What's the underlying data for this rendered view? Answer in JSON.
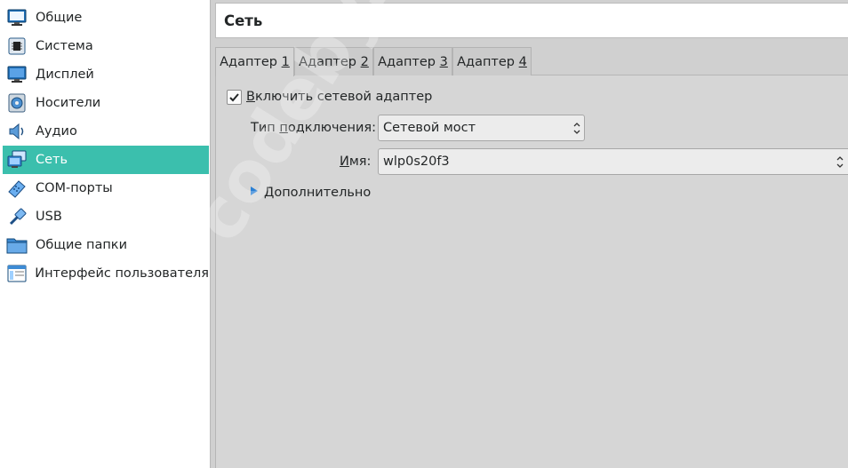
{
  "sidebar": {
    "items": [
      {
        "label": "Общие",
        "icon": "general-icon",
        "active": false
      },
      {
        "label": "Система",
        "icon": "system-chip-icon",
        "active": false
      },
      {
        "label": "Дисплей",
        "icon": "display-monitor-icon",
        "active": false
      },
      {
        "label": "Носители",
        "icon": "storage-disk-icon",
        "active": false
      },
      {
        "label": "Аудио",
        "icon": "audio-speaker-icon",
        "active": false
      },
      {
        "label": "Сеть",
        "icon": "network-icon",
        "active": true
      },
      {
        "label": "COM-порты",
        "icon": "serial-port-icon",
        "active": false
      },
      {
        "label": "USB",
        "icon": "usb-icon",
        "active": false
      },
      {
        "label": "Общие папки",
        "icon": "shared-folder-icon",
        "active": false
      },
      {
        "label": "Интерфейс пользователя",
        "icon": "user-interface-icon",
        "active": false
      }
    ]
  },
  "header": {
    "title": "Сеть"
  },
  "tabs": [
    {
      "prefix": "Адаптер ",
      "mnemonic": "1",
      "active": true
    },
    {
      "prefix": "Адаптер ",
      "mnemonic": "2",
      "active": false
    },
    {
      "prefix": "Адаптер ",
      "mnemonic": "3",
      "active": false
    },
    {
      "prefix": "Адаптер ",
      "mnemonic": "4",
      "active": false
    }
  ],
  "adapter": {
    "enable_prefix": "",
    "enable_mnemonic": "В",
    "enable_rest": "ключить сетевой адаптер",
    "enabled": true,
    "attachment_label_prefix": "Тип ",
    "attachment_label_mnemonic": "п",
    "attachment_label_rest": "одключения:",
    "attachment_value": "Сетевой мост",
    "name_label_mnemonic": "И",
    "name_label_rest": "мя:",
    "name_value": "wlp0s20f3",
    "advanced_mnemonic": "Д",
    "advanced_rest": "ополнительно"
  },
  "watermark": "codeby.net",
  "colors": {
    "accent": "#3bbfad",
    "panel": "#d6d6d6",
    "sidebar": "#ffffff",
    "arrow": "#2a7fd4"
  }
}
